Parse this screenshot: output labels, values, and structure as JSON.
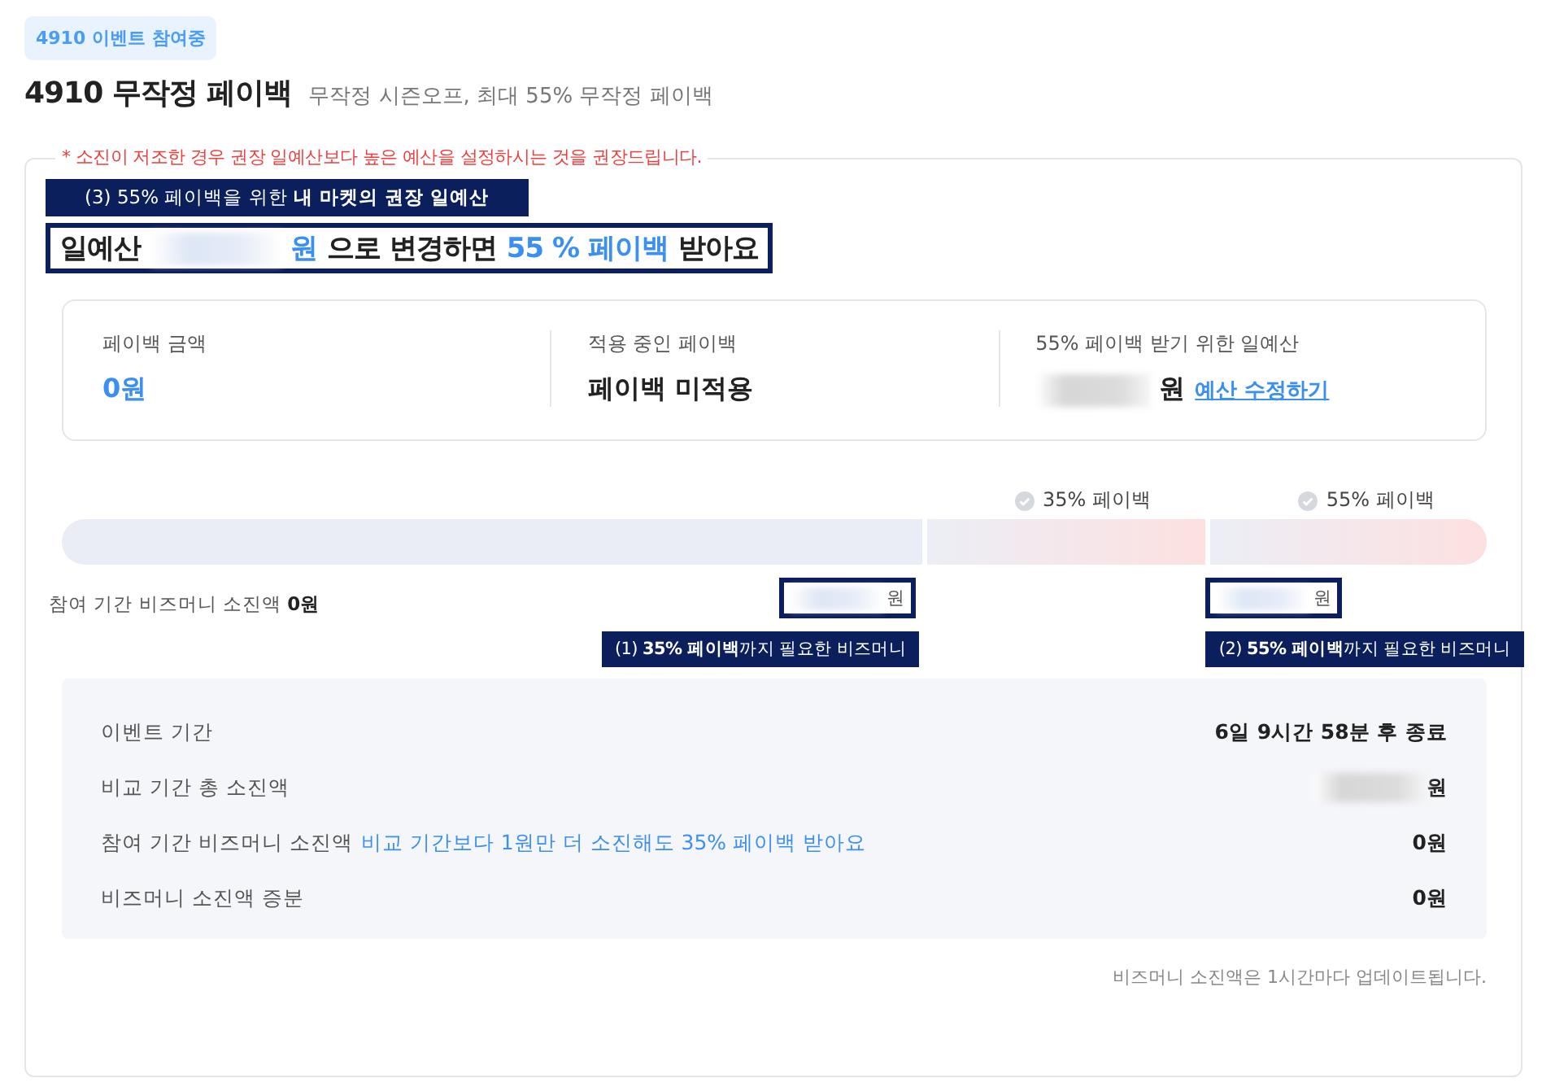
{
  "badge": "4910 이벤트 참여중",
  "title": "4910 무작정 페이백",
  "subtitle": "무작정 시즌오프, 최대 55% 무작정 페이백",
  "notice": "* 소진이 저조한 경우 권장 일예산보다 높은 예산을 설정하시는 것을 권장드립니다.",
  "recommend_annotation": "(3) 55% 페이백을 위한 **내 마켓의 권장 일예산**",
  "headline": [
    {
      "text": "일예산",
      "kind": "plain"
    },
    {
      "kind": "redacted"
    },
    {
      "text": "원",
      "kind": "accent"
    },
    {
      "text": "으로 변경하면",
      "kind": "plain"
    },
    {
      "text": "55 % 페이백",
      "kind": "accent"
    },
    {
      "text": "받아요",
      "kind": "plain"
    }
  ],
  "summary": [
    {
      "label": "페이백 금액",
      "value": "0원",
      "kind": "accent"
    },
    {
      "label": "적용 중인 페이백",
      "value": "페이백 미적용",
      "kind": "plain"
    },
    {
      "label": "55% 페이백 받기 위한 일예산",
      "value": "원",
      "kind": "redacted",
      "link": "예산 수정하기"
    }
  ],
  "milestones": [
    {
      "label": "35% 페이백",
      "achieved": false,
      "annotation": "(1) **35% 페이백**까지 필요한 비즈머니",
      "unit": "원"
    },
    {
      "label": "55% 페이백",
      "achieved": false,
      "annotation": "(2) **55% 페이백**까지 필요한 비즈머니",
      "unit": "원"
    }
  ],
  "spent": "참여 기간 비즈머니 소진액 **0원**",
  "details": [
    {
      "label": "이벤트 기간",
      "value": "6일 9시간 58분 후 종료",
      "redacted": false
    },
    {
      "label": "비교 기간 총 소진액",
      "value": "원",
      "redacted": true
    },
    {
      "label": "참여 기간 비즈머니 소진액",
      "note": "비교 기간보다 1원만 더 소진해도 35% 페이백 받아요",
      "value": "0원",
      "redacted": false
    },
    {
      "label": "비즈머니 소진액 증분",
      "value": "0원",
      "redacted": false
    }
  ],
  "footer": "비즈머니 소진액은 1시간마다 업데이트됩니다."
}
